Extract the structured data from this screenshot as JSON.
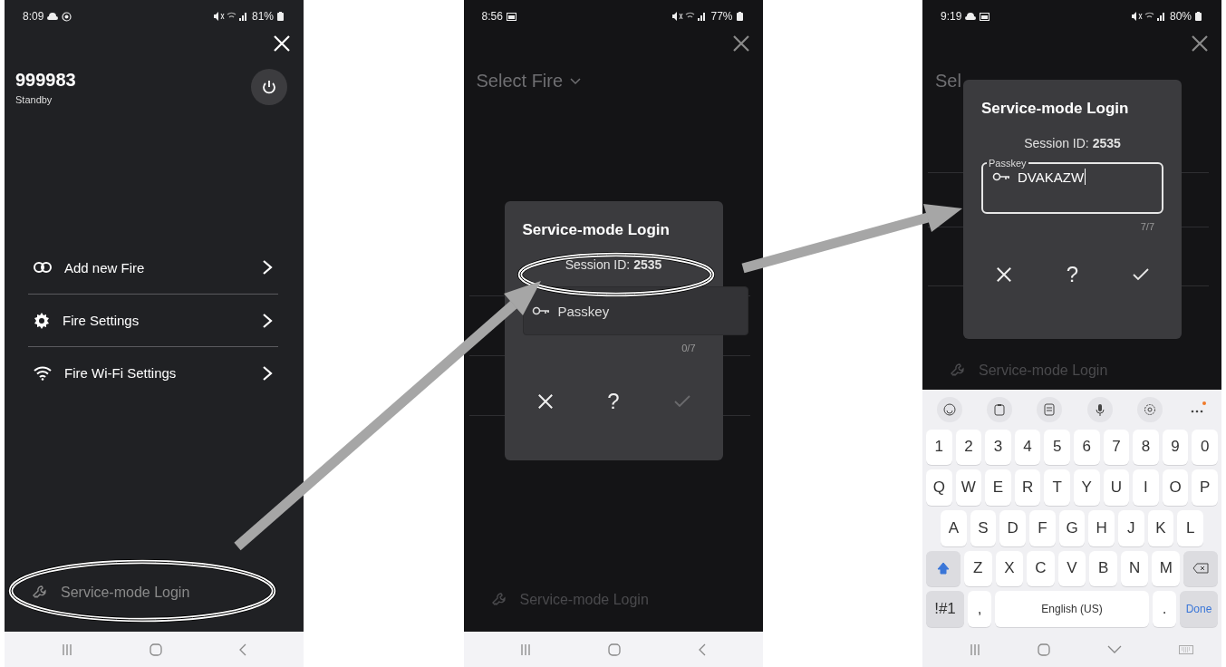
{
  "screens": [
    {
      "kind": "menu",
      "status_bar": {
        "time": "8:09",
        "battery": "81%"
      },
      "device": {
        "name": "999983",
        "status": "Standby"
      },
      "menu": [
        {
          "label": "Add new Fire"
        },
        {
          "label": "Fire Settings"
        },
        {
          "label": "Fire Wi-Fi Settings"
        }
      ],
      "footer_link": "Service-mode Login",
      "nav": {
        "kind": "back"
      }
    },
    {
      "kind": "dialog",
      "status_bar": {
        "time": "8:56",
        "battery": "77%"
      },
      "header": {
        "text": "Select Fire",
        "chevron": true
      },
      "footer_link": "Service-mode Login",
      "dialog": {
        "title": "Service-mode Login",
        "session": "Session ID: **2535**",
        "field": {
          "focused": false,
          "placeholder": "Passkey",
          "counter": "0/7"
        },
        "help": "?",
        "confirm_disabled": true
      },
      "nav": {
        "kind": "back"
      }
    },
    {
      "kind": "dialog",
      "status_bar": {
        "time": "9:19",
        "battery": "80%"
      },
      "header": {
        "text": "Sel",
        "chevron": false
      },
      "footer_link": "Service-mode Login",
      "dialog": {
        "title": "Service-mode Login",
        "session": "Session ID: **2535**",
        "field": {
          "focused": true,
          "label": "Passkey",
          "value": "DVAKAZW",
          "counter": "7/7"
        },
        "help": "?",
        "confirm_disabled": false
      },
      "keyboard": {
        "rows": [
          [
            "1",
            "2",
            "3",
            "4",
            "5",
            "6",
            "7",
            "8",
            "9",
            "0"
          ],
          [
            "Q",
            "W",
            "E",
            "R",
            "T",
            "Y",
            "U",
            "I",
            "O",
            "P"
          ],
          [
            "A",
            "S",
            "D",
            "F",
            "G",
            "H",
            "J",
            "K",
            "L"
          ],
          [
            "Z",
            "X",
            "C",
            "V",
            "B",
            "N",
            "M"
          ]
        ],
        "shift_on": true,
        "symbols": "!#1",
        "comma": ",",
        "space": "English (US)",
        "period": ".",
        "done": "Done"
      },
      "nav": {
        "kind": "keyboard"
      }
    }
  ]
}
